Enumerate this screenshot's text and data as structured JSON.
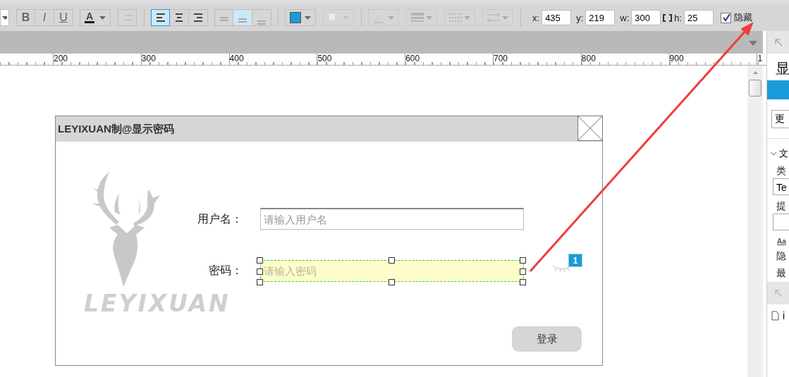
{
  "toolbar": {
    "format_buttons": [
      {
        "label": "B",
        "kind": "bold"
      },
      {
        "label": "I",
        "kind": "italic"
      },
      {
        "label": "U",
        "kind": "underline"
      }
    ],
    "font_color": {
      "label": "A",
      "color": "#1a1a1a"
    },
    "bullet_list": {
      "disabled": true
    },
    "align_buttons": [
      {
        "kind": "left",
        "selected": true
      },
      {
        "kind": "center",
        "selected": false
      },
      {
        "kind": "right",
        "selected": false
      }
    ],
    "valign_buttons": [
      {
        "kind": "top",
        "selected": false
      },
      {
        "kind": "middle",
        "selected": true
      },
      {
        "kind": "bottom",
        "selected": false
      }
    ],
    "fill_color": {
      "color": "#1a9bd7"
    },
    "geometry": [
      {
        "label": "x:",
        "value": "435"
      },
      {
        "label": "y:",
        "value": "219"
      },
      {
        "label": "w:",
        "value": "300"
      },
      {
        "label": "h:",
        "value": "25",
        "locked": true
      }
    ],
    "hidden": {
      "label": "隐藏",
      "checked": true
    }
  },
  "ruler": {
    "labels": [
      "200",
      "300",
      "400",
      "500",
      "600",
      "700",
      "800",
      "900",
      "1"
    ]
  },
  "dialog": {
    "title": "LEYIXUAN制@显示密码",
    "logo_text": "LEYIXUAN",
    "fields": [
      {
        "label": "用户名：",
        "placeholder": "请输入用户名",
        "selected": false
      },
      {
        "label": "密码：",
        "placeholder": "请输入密码",
        "selected": true
      }
    ],
    "badge": "1",
    "login_button": "登录"
  },
  "right_panel": {
    "heading": "显",
    "button": "更",
    "section": "文",
    "type_label": "类",
    "type_value": "Te",
    "hint_label": "提",
    "font_icon": "Aa",
    "hide_label": "隐",
    "max_label": "最",
    "file": "i"
  }
}
